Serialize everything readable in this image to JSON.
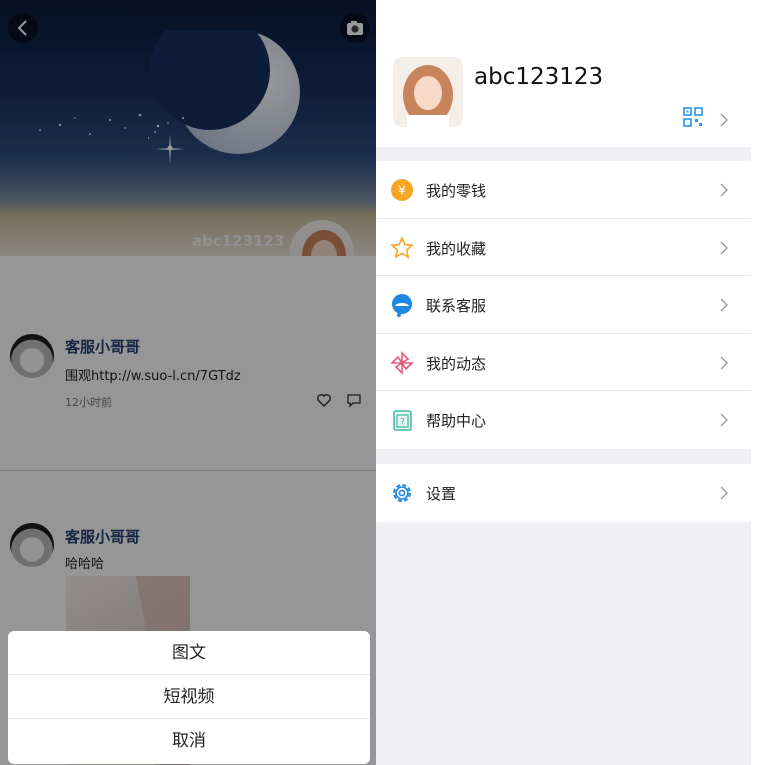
{
  "left": {
    "cover": {
      "username": "abc123123"
    },
    "posts": [
      {
        "name": "客服小哥哥",
        "text": "围观http://w.suo-l.cn/7GTdz",
        "time": "12小时前"
      },
      {
        "name": "客服小哥哥",
        "text": "哈哈哈"
      }
    ],
    "action_sheet": {
      "items": [
        "图文",
        "短视频",
        "取消"
      ]
    }
  },
  "right": {
    "profile": {
      "username": "abc123123"
    },
    "menu": [
      {
        "label": "我的零钱",
        "icon": "coin-icon",
        "color": "#f5a623"
      },
      {
        "label": "我的收藏",
        "icon": "star-icon",
        "color": "#f5a623"
      },
      {
        "label": "联系客服",
        "icon": "service-icon",
        "color": "#1e88e5"
      },
      {
        "label": "我的动态",
        "icon": "pinwheel-icon",
        "color": "#e25a7a"
      },
      {
        "label": "帮助中心",
        "icon": "help-icon",
        "color": "#3cb8a0"
      }
    ],
    "settings": {
      "label": "设置",
      "icon": "gear-icon",
      "color": "#1e88e5"
    }
  }
}
